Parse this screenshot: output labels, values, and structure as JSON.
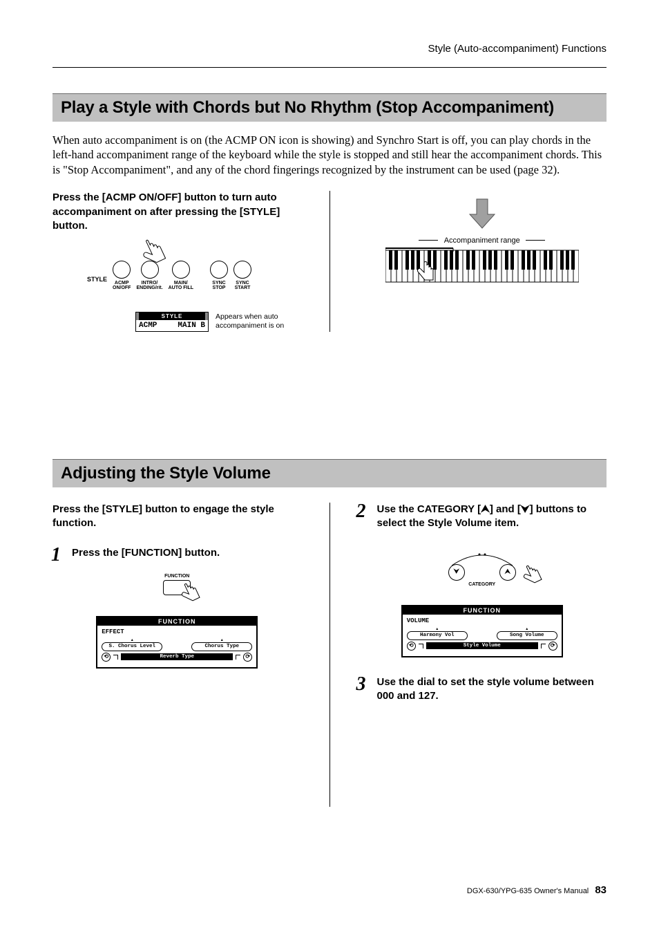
{
  "header": {
    "section_title": "Style (Auto-accompaniment) Functions"
  },
  "section1": {
    "title": "Play a Style with Chords but No Rhythm (Stop Accompaniment)",
    "paragraph": "When auto accompaniment is on (the ACMP ON icon is showing) and Synchro Start is off, you can play chords in the left-hand accompaniment range of the keyboard while the style is stopped and still hear the accompaniment chords. This is \"Stop Accompaniment\", and any of the chord fingerings recognized by the instrument can be used (page 32).",
    "instruction": "Press the [ACMP ON/OFF] button to turn auto accompaniment on after pressing the [STYLE] button.",
    "panel": {
      "style_label": "STYLE",
      "buttons": [
        "ACMP\nON/OFF",
        "INTRO/\nENDING/rit.",
        "MAIN/\nAUTO FILL",
        "SYNC\nSTOP",
        "SYNC\nSTART"
      ]
    },
    "lcd": {
      "header": "STYLE",
      "left": "ACMP",
      "right": "MAIN B",
      "caption": "Appears when auto accompaniment is on"
    },
    "keyboard_label": "Accompaniment range"
  },
  "section2": {
    "title": "Adjusting the Style Volume",
    "instruction": "Press the [STYLE] button to engage the style function.",
    "steps": {
      "s1": {
        "num": "1",
        "text": "Press the [FUNCTION] button."
      },
      "s2": {
        "num": "2",
        "text_a": "Use the CATEGORY [",
        "arrow_up": "⮝",
        "text_b": "] and [",
        "arrow_down": "⮟",
        "text_c": "] buttons to select the Style Volume item."
      },
      "s3": {
        "num": "3",
        "text": "Use the dial to set the style volume between 000 and 127."
      }
    },
    "function_fig": {
      "label": "FUNCTION"
    },
    "lcd_a": {
      "header": "FUNCTION",
      "tag": "EFFECT",
      "left_pill": "S. Chorus Level",
      "right_pill": "Chorus Type",
      "bar": "Reverb Type"
    },
    "lcd_b": {
      "header": "FUNCTION",
      "tag": "VOLUME",
      "left_pill": "Harmony Vol",
      "right_pill": "Song Volume",
      "bar": "Style Volume"
    },
    "category_label": "CATEGORY"
  },
  "footer": {
    "manual": "DGX-630/YPG-635  Owner's Manual",
    "page": "83"
  }
}
